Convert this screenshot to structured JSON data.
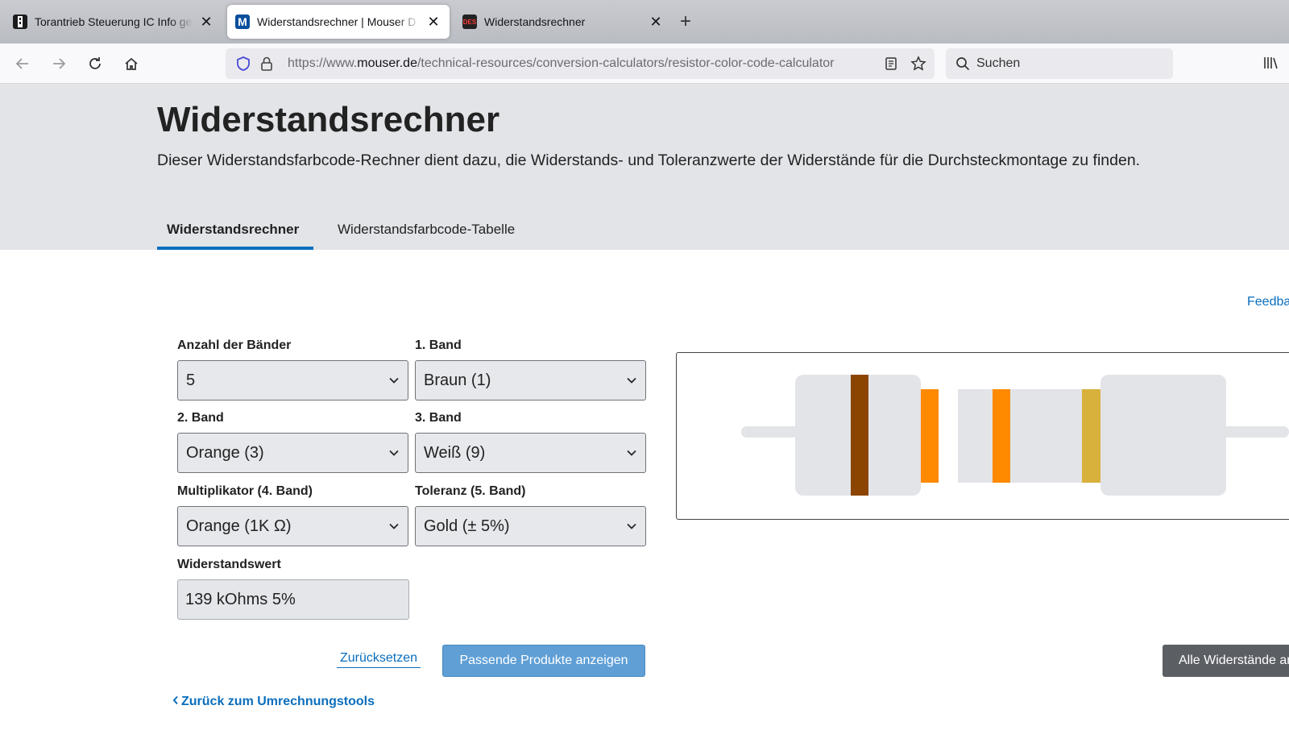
{
  "browser": {
    "tabs": [
      {
        "title": "Torantrieb Steuerung IC Info ge",
        "favicon": "tab-favicon-1",
        "color": "#1b1b1b",
        "glyph": "▮"
      },
      {
        "title": "Widerstandsrechner | Mouser D",
        "favicon": "mouser-favicon",
        "color": "#0a4f9c",
        "glyph": "M"
      },
      {
        "title": "Widerstandsrechner",
        "favicon": "tab-favicon-3",
        "color": "#222222",
        "glyph": "DES"
      }
    ],
    "url": {
      "prefix": "https://www.",
      "domain": "mouser.de",
      "path": "/technical-resources/conversion-calculators/resistor-color-code-calculator"
    },
    "search_placeholder": "Suchen"
  },
  "page": {
    "title": "Widerstandsrechner",
    "description": "Dieser Widerstandsfarbcode-Rechner dient dazu, die Widerstands- und Toleranzwerte der Widerstände für die Durchsteckmontage zu finden.",
    "tabs": [
      "Widerstandsrechner",
      "Widerstandsfarbcode-Tabelle"
    ],
    "feedback": "Feedback"
  },
  "form": {
    "band_count": {
      "label": "Anzahl der Bänder",
      "value": "5"
    },
    "band1": {
      "label": "1. Band",
      "value": "Braun (1)"
    },
    "band2": {
      "label": "2. Band",
      "value": "Orange (3)"
    },
    "band3": {
      "label": "3. Band",
      "value": "Weiß (9)"
    },
    "multiplier": {
      "label": "Multiplikator (4. Band)",
      "value": "Orange (1K Ω)"
    },
    "tolerance": {
      "label": "Toleranz (5. Band)",
      "value": "Gold (± 5%)"
    },
    "result": {
      "label": "Widerstandswert",
      "value": "139 kOhms 5%"
    }
  },
  "actions": {
    "reset": "Zurücksetzen",
    "show_products": "Passende Produkte anzeigen",
    "all_resistors": "Alle Widerstände anzeigen",
    "back": "Zurück zum Umrechnungstools"
  },
  "resistor": {
    "band_colors": [
      "#8b4500",
      "#ff8a00",
      "#eeeeee",
      "#ff8a00",
      "#d7b13b"
    ],
    "body_color": "#e2e4e8"
  }
}
